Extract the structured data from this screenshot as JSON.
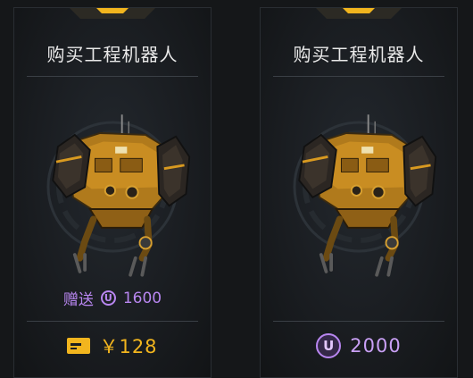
{
  "cards": [
    {
      "title": "购买工程机器人",
      "bonus_label": "赠送",
      "bonus_icon": "u-coin-icon",
      "bonus_icon_glyph": "U",
      "bonus_amount": "1600",
      "price_icon": "payment-card-icon",
      "price_text": "￥128",
      "price_color": "#f2b51e"
    },
    {
      "title": "购买工程机器人",
      "price_icon": "u-coin-icon",
      "price_icon_glyph": "U",
      "price_text": "2000",
      "price_color": "#c9a0f5"
    }
  ],
  "colors": {
    "accent_gold": "#f2b51e",
    "accent_purple": "#b886f0",
    "background": "#151719"
  }
}
